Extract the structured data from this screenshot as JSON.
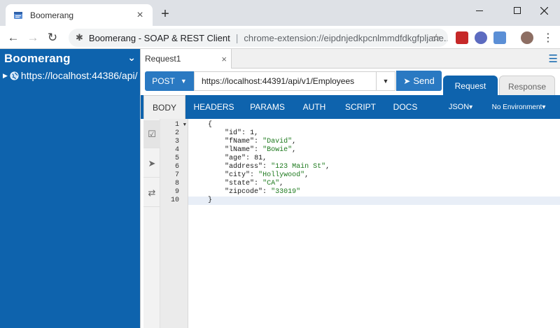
{
  "browser": {
    "tab_title": "Boomerang",
    "omnibox_site": "Boomerang - SOAP & REST Client",
    "omnibox_url": "chrome-extension://eipdnjedkpcnlmmdfdkgfpljane...",
    "new_tab_label": "+"
  },
  "sidebar": {
    "title": "Boomerang",
    "items": [
      {
        "label": "https://localhost:44386/api/"
      }
    ]
  },
  "request_tab": {
    "label": "Request1",
    "close": "×"
  },
  "request": {
    "method": "POST",
    "url": "https://localhost:44391/api/v1/Employees",
    "send_label": "Send"
  },
  "panel_tabs": {
    "request": "Request",
    "response": "Response"
  },
  "subnav": {
    "items": [
      "BODY",
      "HEADERS",
      "PARAMS",
      "AUTH",
      "SCRIPT",
      "DOCS"
    ],
    "format": "JSON",
    "environment": "No Environment"
  },
  "editor": {
    "line_numbers": [
      "1",
      "2",
      "3",
      "4",
      "5",
      "6",
      "7",
      "8",
      "9",
      "10"
    ],
    "active_line": 10,
    "lines": [
      "{",
      "    \"id\": 1,",
      "    \"fName\": \"David\",",
      "    \"lName\": \"Bowie\",",
      "    \"age\": 81,",
      "    \"address\": \"123 Main St\",",
      "    \"city\": \"Hollywood\",",
      "    \"state\": \"CA\",",
      "    \"zipcode\": \"33019\"",
      "}"
    ]
  },
  "colors": {
    "brand_blue": "#0e63ad",
    "button_blue": "#2a79c2",
    "string_green": "#1e7a1e"
  }
}
